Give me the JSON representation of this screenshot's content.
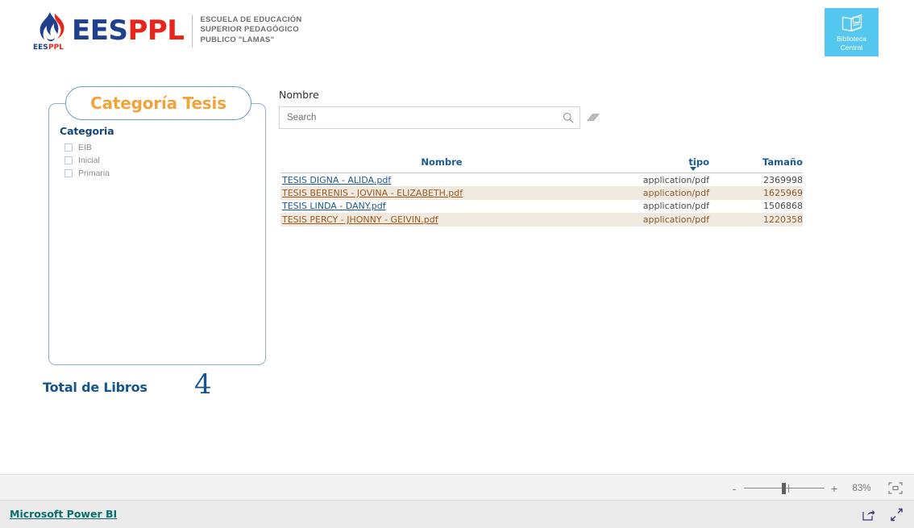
{
  "header": {
    "logo": {
      "mark_icon": "flame-torch-icon",
      "word_first": "EES",
      "word_second": "PPL",
      "badge_text": "EESPPL",
      "subtitle_line1": "ESCUELA DE EDUCACIÓN",
      "subtitle_line2": "SUPERIOR PEDAGÓGICO",
      "subtitle_line3": "PUBLICO \"LAMAS\"",
      "color_blue": "#1F3F8F",
      "color_red": "#E8251C"
    },
    "biblioteca_tile": {
      "icon": "open-book-icon",
      "label_line1": "Biblioteca",
      "label_line2": "Central",
      "background": "#54C8F0"
    }
  },
  "slicer": {
    "title": "Categoría Tesis",
    "title_color": "#F2A33C",
    "field_header": "Categoria",
    "items": [
      {
        "label": "EIB",
        "checked": false
      },
      {
        "label": "Inicial",
        "checked": false
      },
      {
        "label": "Primaria",
        "checked": false
      }
    ]
  },
  "total_card": {
    "label": "Total de Libros",
    "value": "4",
    "color": "#14558E"
  },
  "search": {
    "label": "Nombre",
    "placeholder": "Search",
    "value": "",
    "search_icon": "magnifier-icon",
    "clear_icon": "eraser-icon"
  },
  "table": {
    "columns": [
      {
        "key": "nombre",
        "label": "Nombre",
        "align": "center"
      },
      {
        "key": "tipo",
        "label": "tipo",
        "align": "right",
        "sorted": "desc"
      },
      {
        "key": "tamano",
        "label": "Tamaño",
        "align": "right"
      }
    ],
    "rows": [
      {
        "nombre": "TESIS DIGNA - ALIDA.pdf",
        "tipo": "application/pdf",
        "tamano": "2369998"
      },
      {
        "nombre": "TESIS BERENIS - JOVINA - ELIZABETH.pdf",
        "tipo": "application/pdf",
        "tamano": "1625969"
      },
      {
        "nombre": "TESIS LINDA - DANY.pdf",
        "tipo": "application/pdf",
        "tamano": "1506868"
      },
      {
        "nombre": "TESIS PERCY - JHONNY - GEIVIN.pdf",
        "tipo": "application/pdf",
        "tamano": "1220358"
      }
    ],
    "header_color": "#1A5A96",
    "alt_row_background": "#F0E9E0"
  },
  "toolbar": {
    "zoom_out_label": "-",
    "zoom_in_label": "+",
    "zoom_percent": "83%",
    "fit_icon": "fit-to-page-icon"
  },
  "footer": {
    "brand_link": "Microsoft Power BI",
    "brand_color": "#0B6E6E",
    "share_icon": "share-icon",
    "fullscreen_icon": "fullscreen-icon"
  }
}
